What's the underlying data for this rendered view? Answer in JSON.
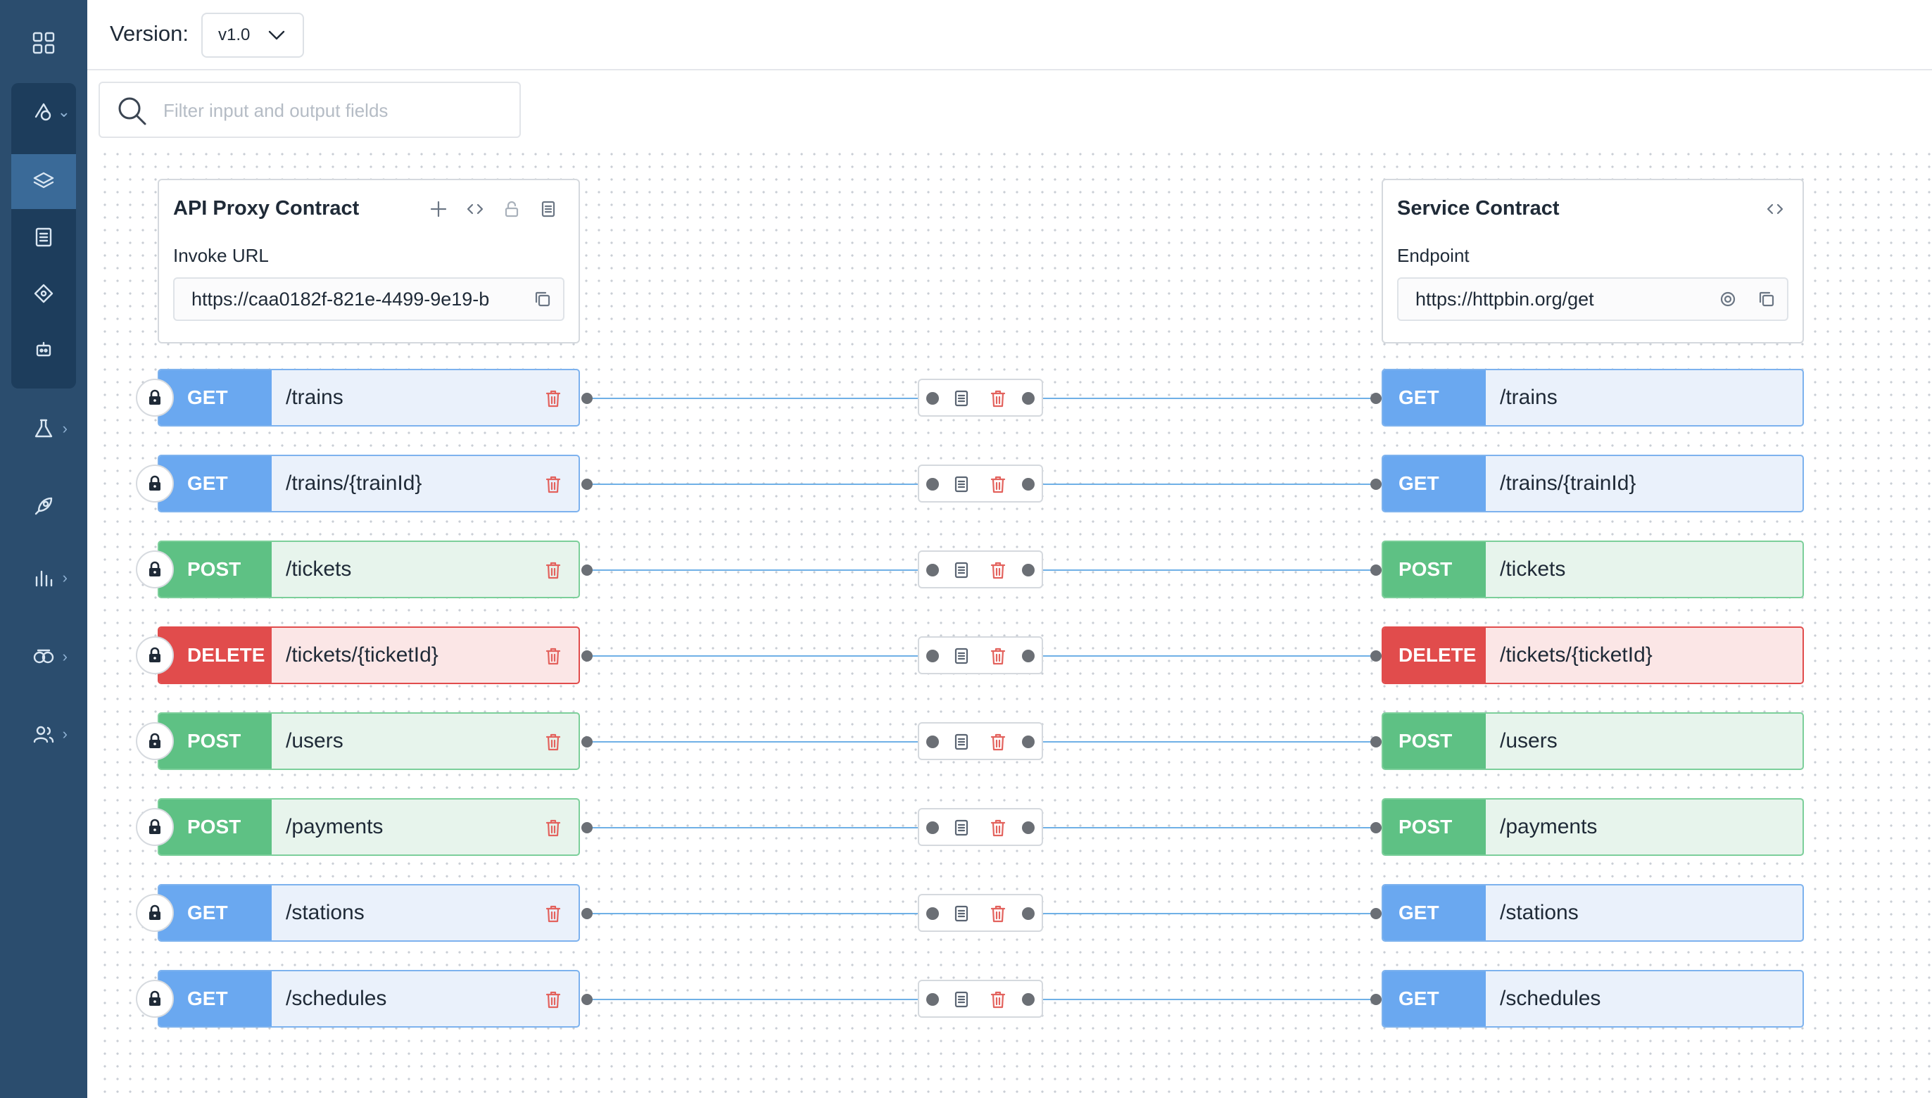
{
  "header": {
    "version_label": "Version:",
    "version_value": "v1.0"
  },
  "search": {
    "placeholder": "Filter input and output fields"
  },
  "sidebar": {
    "items": [
      {
        "name": "apps-grid-icon"
      },
      {
        "name": "api-icon"
      },
      {
        "name": "layers-icon"
      },
      {
        "name": "document-icon"
      },
      {
        "name": "policy-icon"
      },
      {
        "name": "robot-icon"
      },
      {
        "name": "test-flask-icon"
      },
      {
        "name": "deploy-rocket-icon"
      },
      {
        "name": "analytics-icon"
      },
      {
        "name": "governance-icon"
      },
      {
        "name": "users-icon"
      }
    ]
  },
  "proxy_contract": {
    "title": "API Proxy Contract",
    "field_label": "Invoke URL",
    "url": "https://caa0182f-821e-4499-9e19-b"
  },
  "service_contract": {
    "title": "Service Contract",
    "field_label": "Endpoint",
    "url": "https://httpbin.org/get"
  },
  "operations": [
    {
      "method": "GET",
      "path": "/trains",
      "target_method": "GET",
      "target_path": "/trains"
    },
    {
      "method": "GET",
      "path": "/trains/{trainId}",
      "target_method": "GET",
      "target_path": "/trains/{trainId}"
    },
    {
      "method": "POST",
      "path": "/tickets",
      "target_method": "POST",
      "target_path": "/tickets"
    },
    {
      "method": "DELETE",
      "path": "/tickets/{ticketId}",
      "target_method": "DELETE",
      "target_path": "/tickets/{ticketId}"
    },
    {
      "method": "POST",
      "path": "/users",
      "target_method": "POST",
      "target_path": "/users"
    },
    {
      "method": "POST",
      "path": "/payments",
      "target_method": "POST",
      "target_path": "/payments"
    },
    {
      "method": "GET",
      "path": "/stations",
      "target_method": "GET",
      "target_path": "/stations"
    },
    {
      "method": "GET",
      "path": "/schedules",
      "target_method": "GET",
      "target_path": "/schedules"
    }
  ],
  "colors": {
    "sidebar": "#2b4d6e",
    "get": "#6aa8f0",
    "post": "#5ec184",
    "delete": "#e14c4c",
    "wire": "#6fb0e6"
  }
}
